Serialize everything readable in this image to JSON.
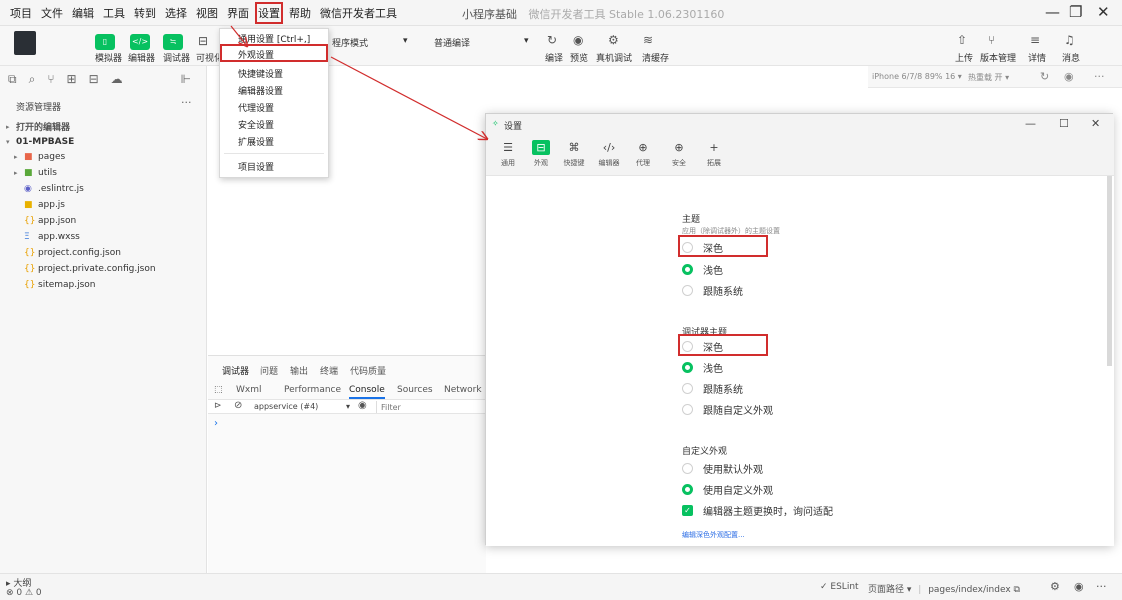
{
  "menubar": {
    "items": [
      "项目",
      "文件",
      "编辑",
      "工具",
      "转到",
      "选择",
      "视图",
      "界面",
      "设置",
      "帮助",
      "微信开发者工具"
    ],
    "title": "小程序基础",
    "subtitle": "微信开发者工具 Stable 1.06.2301160"
  },
  "toolbar": {
    "simulator": "模拟器",
    "editor": "编辑器",
    "debugger": "调试器",
    "visual": "可视化",
    "mode": "程序模式",
    "compile_mode": "普通编译",
    "compile": "编译",
    "preview": "预览",
    "remote_debug": "真机调试",
    "clear_cache": "清缓存",
    "upload": "上传",
    "version": "版本管理",
    "details": "详情",
    "messages": "消息"
  },
  "explorer": {
    "title": "资源管理器",
    "more": "···",
    "open_editors": "打开的编辑器",
    "project": "01-MPBASE",
    "files": [
      {
        "name": "pages",
        "icon": "folder-icon"
      },
      {
        "name": "utils",
        "icon": "folder-icon"
      },
      {
        "name": ".eslintrc.js",
        "icon": "eslint-icon"
      },
      {
        "name": "app.js",
        "icon": "js-icon"
      },
      {
        "name": "app.json",
        "icon": "json-icon"
      },
      {
        "name": "app.wxss",
        "icon": "wxss-icon"
      },
      {
        "name": "project.config.json",
        "icon": "json-icon"
      },
      {
        "name": "project.private.config.json",
        "icon": "json-icon"
      },
      {
        "name": "sitemap.json",
        "icon": "json-icon"
      }
    ]
  },
  "simbar": {
    "device": "iPhone 6/7/8 89% 16 ▾",
    "hot_reload": "热重载 开 ▾"
  },
  "debug_panel": {
    "tabs": [
      "调试器",
      "问题",
      "输出",
      "终端",
      "代码质量"
    ],
    "devtools_tabs": [
      "Wxml",
      "Performance",
      "Console",
      "Sources",
      "Network"
    ],
    "context": "appservice (#4)",
    "filter_placeholder": "Filter",
    "prompt": "›"
  },
  "settings_menu": {
    "items": [
      "通用设置  [Ctrl+,]",
      "外观设置",
      "快捷键设置",
      "编辑器设置",
      "代理设置",
      "安全设置",
      "扩展设置",
      "项目设置"
    ]
  },
  "settings_dialog": {
    "title": "设置",
    "tabs": [
      "通用",
      "外观",
      "快捷键",
      "编辑器",
      "代理",
      "安全",
      "拓展"
    ],
    "theme": {
      "title": "主题",
      "desc": "应用（除调试器外）的主题设置",
      "options": [
        "深色",
        "浅色",
        "跟随系统"
      ]
    },
    "debugger_theme": {
      "title": "调试器主题",
      "options": [
        "深色",
        "浅色",
        "跟随系统",
        "跟随自定义外观"
      ]
    },
    "custom": {
      "title": "自定义外观",
      "options": [
        "使用默认外观",
        "使用自定义外观"
      ],
      "checkbox": "编辑器主题更换时，询问适配",
      "link": "编辑深色外观配置..."
    }
  },
  "statusbar": {
    "outline": "大纲",
    "counts": "⊗ 0 ⚠ 0",
    "eslint": "✓ ESLint",
    "page_path": "页面路径 ▾",
    "page": "pages/index/index"
  },
  "colors": {
    "accent": "#07c160",
    "highlight": "#d12d2d",
    "link": "#2b6de5"
  }
}
